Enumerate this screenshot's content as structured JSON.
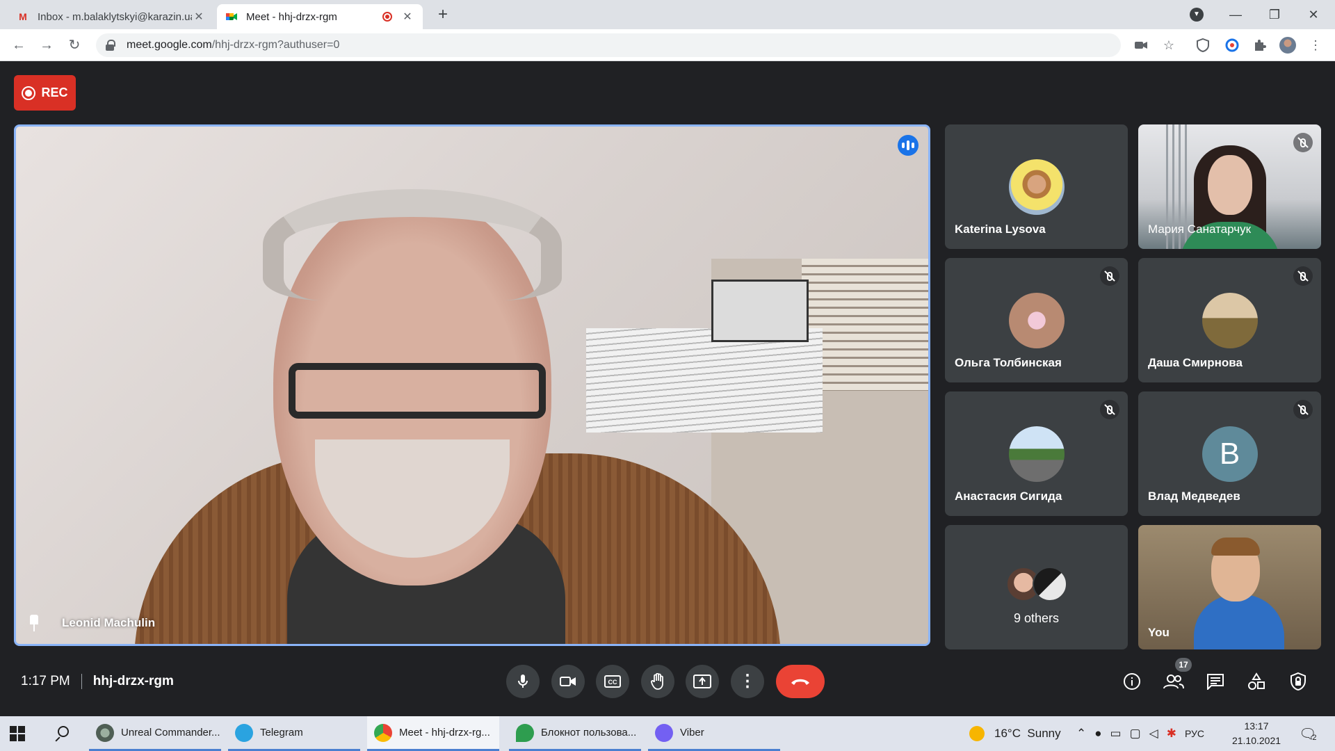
{
  "browser": {
    "tabs": [
      {
        "title": "Inbox - m.balaklytskyi@karazin.ua",
        "favicon": "gmail-icon",
        "active": false
      },
      {
        "title": "Meet - hhj-drzx-rgm",
        "favicon": "meet-icon",
        "active": true
      }
    ],
    "address": {
      "host": "meet.google.com",
      "path": "/hhj-drzx-rgm?authuser=0"
    }
  },
  "meet": {
    "rec_label": "REC",
    "main_speaker": {
      "name": "Leonid Machulin"
    },
    "participants": [
      {
        "name": "Katerina Lysova",
        "muted": false,
        "type": "photo-avatar"
      },
      {
        "name": "Мария Санатарчук",
        "muted": true,
        "type": "video"
      },
      {
        "name": "Ольга Толбинская",
        "muted": true,
        "type": "photo-avatar"
      },
      {
        "name": "Даша Смирнова",
        "muted": true,
        "type": "photo-avatar"
      },
      {
        "name": "Анастасия Сигида",
        "muted": true,
        "type": "photo-avatar"
      },
      {
        "name": "Влад Медведев",
        "muted": true,
        "type": "letter-avatar",
        "letter": "B"
      },
      {
        "name": "9 others",
        "type": "others"
      },
      {
        "name": "You",
        "type": "video"
      }
    ],
    "bottom": {
      "time": "1:17 PM",
      "meeting_code": "hhj-drzx-rgm",
      "people_count": "17"
    }
  },
  "taskbar": {
    "apps": [
      {
        "label": "Unreal Commander...",
        "active": false
      },
      {
        "label": "Telegram",
        "active": false
      },
      {
        "label": "Meet - hhj-drzx-rg...",
        "active": true
      },
      {
        "label": "Блокнот пользова...",
        "active": false
      },
      {
        "label": "Viber",
        "active": false
      }
    ],
    "weather": "16°C  Sunny",
    "language": "РУС",
    "time": "13:17",
    "date": "21.10.2021",
    "notification_count": "2"
  },
  "colors": {
    "meet_bg": "#202124",
    "tile_bg": "#3c4043",
    "rec_red": "#d93025",
    "end_call_red": "#ea4335",
    "speaking_blue": "#1a73e8",
    "active_border": "#8ab4f8"
  }
}
